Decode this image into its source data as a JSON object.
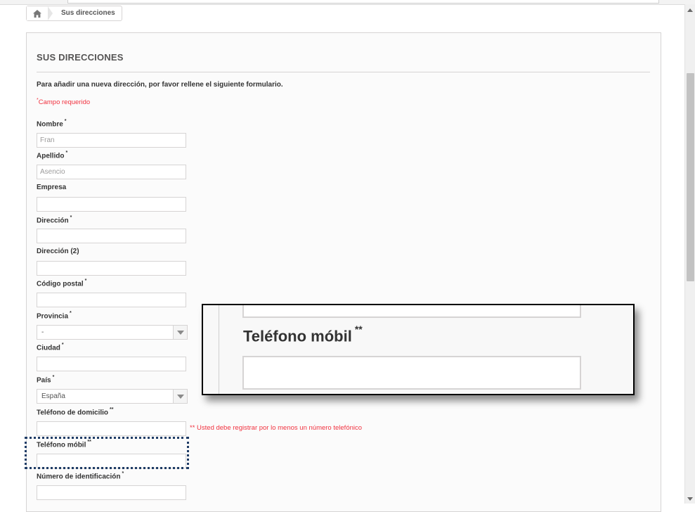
{
  "breadcrumb": {
    "home_icon": "home-icon",
    "current": "Sus direcciones"
  },
  "page": {
    "title": "SUS DIRECCIONES",
    "intro": "Para añadir una nueva dirección, por favor rellene el siguiente formulario.",
    "required_mark": "*",
    "required_text": "Campo requerido"
  },
  "form": {
    "nombre": {
      "label": "Nombre",
      "mark": "*",
      "value": "Fran"
    },
    "apellido": {
      "label": "Apellido",
      "mark": "*",
      "value": "Asencio"
    },
    "empresa": {
      "label": "Empresa",
      "value": ""
    },
    "direccion": {
      "label": "Dirección",
      "mark": "*",
      "value": ""
    },
    "direccion2": {
      "label": "Dirección (2)",
      "value": ""
    },
    "codigo_postal": {
      "label": "Código postal",
      "mark": "*",
      "value": ""
    },
    "provincia": {
      "label": "Provincia",
      "mark": "*",
      "selected": "-"
    },
    "ciudad": {
      "label": "Ciudad",
      "mark": "*",
      "value": ""
    },
    "pais": {
      "label": "País",
      "mark": "*",
      "selected": "España"
    },
    "telefono_domicilio": {
      "label": "Teléfono de domicilio",
      "mark": "**",
      "value": ""
    },
    "phone_note": "** Usted debe registrar por lo menos un número telefónico",
    "telefono_movil": {
      "label": "Teléfono móbil",
      "mark": "**",
      "value": ""
    },
    "numero_identificacion": {
      "label": "Número de identificación",
      "mark": "*",
      "value": ""
    }
  },
  "zoom_callout": {
    "label": "Teléfono móbil",
    "mark": "**"
  },
  "colors": {
    "accent_required": "#f13340",
    "highlight_border": "#1f3c66",
    "text": "#333333",
    "border": "#d6d4d4"
  }
}
